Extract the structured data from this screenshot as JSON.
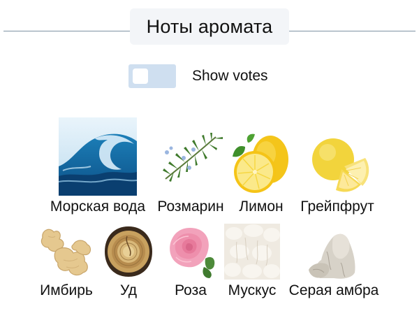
{
  "header": {
    "title": "Ноты аромата"
  },
  "votes_toggle": {
    "label": "Show votes",
    "checked": false
  },
  "notes": [
    {
      "name": "Морская вода",
      "icon": "ocean-wave-image"
    },
    {
      "name": "Розмарин",
      "icon": "rosemary-image"
    },
    {
      "name": "Лимон",
      "icon": "lemon-image"
    },
    {
      "name": "Грейпфрут",
      "icon": "grapefruit-image"
    },
    {
      "name": "Имбирь",
      "icon": "ginger-image"
    },
    {
      "name": "Уд",
      "icon": "oud-wood-image"
    },
    {
      "name": "Роза",
      "icon": "rose-image"
    },
    {
      "name": "Мускус",
      "icon": "musk-image"
    },
    {
      "name": "Серая амбра",
      "icon": "ambergris-image"
    }
  ]
}
